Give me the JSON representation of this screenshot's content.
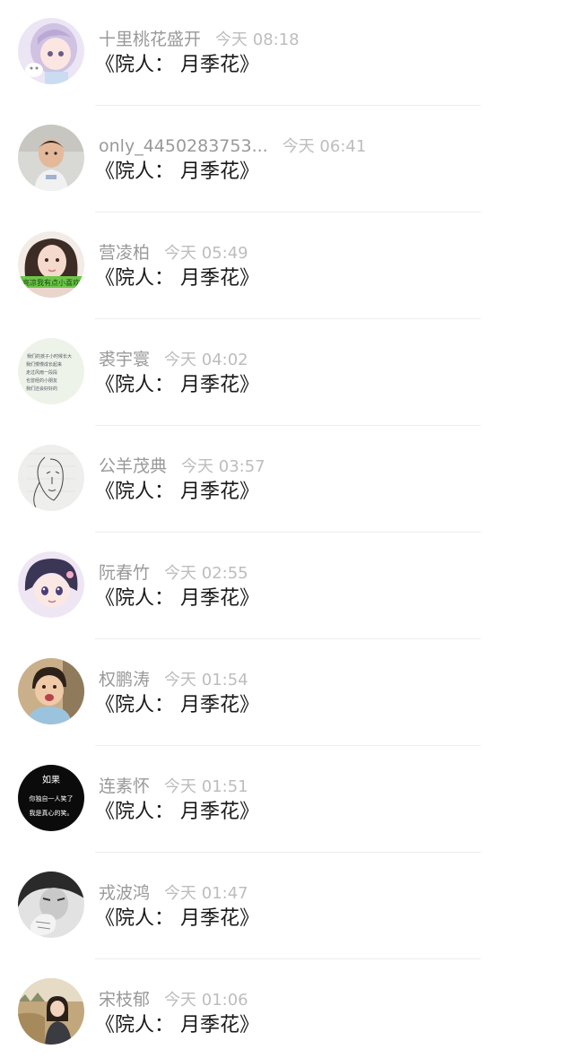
{
  "comments": [
    {
      "name": "十里桃花盛开",
      "time": "今天 08:18",
      "message": "《院人： 月季花》",
      "avatar_icon": "anime-girl-avatar"
    },
    {
      "name": "only_4450283753...",
      "time": "今天 06:41",
      "message": "《院人： 月季花》",
      "avatar_icon": "boy-photo-avatar"
    },
    {
      "name": "营凌柏",
      "time": "今天 05:49",
      "message": "《院人： 月季花》",
      "avatar_icon": "girl-photo-avatar"
    },
    {
      "name": "裘宇寰",
      "time": "今天 04:02",
      "message": "《院人： 月季花》",
      "avatar_icon": "handwriting-note-avatar"
    },
    {
      "name": "公羊茂典",
      "time": "今天 03:57",
      "message": "《院人： 月季花》",
      "avatar_icon": "line-sketch-avatar"
    },
    {
      "name": "阮春竹",
      "time": "今天 02:55",
      "message": "《院人： 月季花》",
      "avatar_icon": "anime-character-avatar"
    },
    {
      "name": "权鹏涛",
      "time": "今天 01:54",
      "message": "《院人： 月季花》",
      "avatar_icon": "child-photo-avatar"
    },
    {
      "name": "连素怀",
      "time": "今天 01:51",
      "message": "《院人： 月季花》",
      "avatar_icon": "text-quote-avatar"
    },
    {
      "name": "戎波鸿",
      "time": "今天 01:47",
      "message": "《院人： 月季花》",
      "avatar_icon": "monochrome-portrait-avatar"
    },
    {
      "name": "宋枝郁",
      "time": "今天 01:06",
      "message": "《院人： 月季花》",
      "avatar_icon": "outdoor-photo-avatar"
    }
  ],
  "avatar_texts": {
    "handwriting": [
      "我们的孩子小时候长大",
      "我们慢慢成长起来",
      "走过风雨一段段",
      "也曾经的小朋友",
      "我们还会好好的"
    ],
    "green_banner": "亮凉我有点小喜欢",
    "quote_title": "如果",
    "quote_line1": "你独自一人笑了",
    "quote_line2": "我是真心的笑。"
  },
  "colors": {
    "name": "#999999",
    "time": "#bdbdbd",
    "message": "#1a1a1a",
    "divider": "#ededed",
    "background": "#ffffff"
  }
}
